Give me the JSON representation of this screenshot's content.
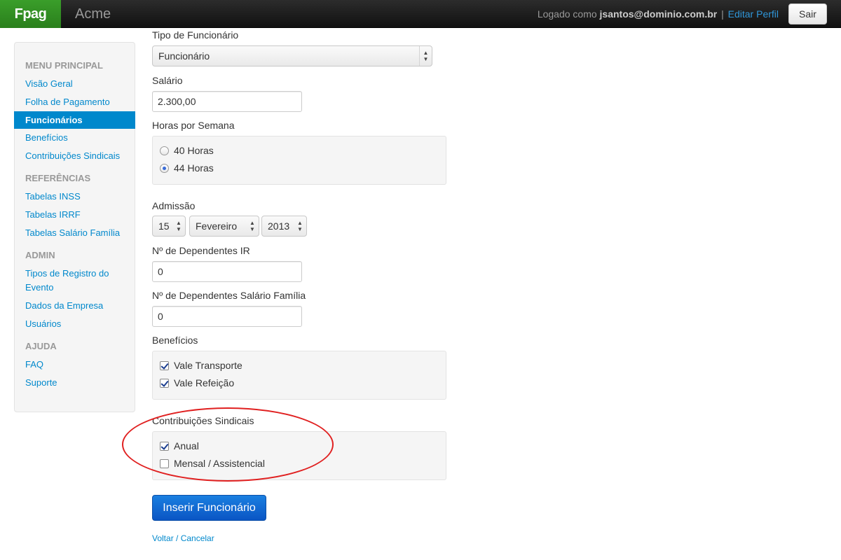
{
  "navbar": {
    "brand": "Fpag",
    "company": "Acme",
    "logged_as_prefix": "Logado como ",
    "username": "jsantos@dominio.com.br",
    "separator": "|",
    "edit_profile": "Editar Perfil",
    "logout": "Sair"
  },
  "sidebar": {
    "sections": [
      {
        "header": "MENU PRINCIPAL",
        "items": [
          "Visão Geral",
          "Folha de Pagamento",
          "Funcionários",
          "Benefícios",
          "Contribuições Sindicais"
        ]
      },
      {
        "header": "REFERÊNCIAS",
        "items": [
          "Tabelas INSS",
          "Tabelas IRRF",
          "Tabelas Salário Família"
        ]
      },
      {
        "header": "ADMIN",
        "items": [
          "Tipos de Registro do",
          "Evento",
          "Dados da Empresa",
          "Usuários"
        ]
      },
      {
        "header": "AJUDA",
        "items": [
          "FAQ",
          "Suporte"
        ]
      }
    ],
    "active": "Funcionários"
  },
  "form": {
    "tipo_label": "Tipo de Funcionário",
    "tipo_value": "Funcionário",
    "salario_label": "Salário",
    "salario_value": "2.300,00",
    "horas_label": "Horas por Semana",
    "horas_options": [
      "40 Horas",
      "44 Horas"
    ],
    "horas_selected": "44 Horas",
    "admissao_label": "Admissão",
    "admissao_day": "15",
    "admissao_month": "Fevereiro",
    "admissao_year": "2013",
    "dep_ir_label": "Nº de Dependentes IR",
    "dep_ir_value": "0",
    "dep_sf_label": "Nº de Dependentes Salário Família",
    "dep_sf_value": "0",
    "beneficios_label": "Benefícios",
    "beneficios_options": [
      "Vale Transporte",
      "Vale Refeição"
    ],
    "contrib_label": "Contribuições Sindicais",
    "contrib_options": [
      "Anual",
      "Mensal / Assistencial"
    ],
    "submit_label": "Inserir Funcionário",
    "cancel_label": "Voltar / Cancelar"
  },
  "colors": {
    "brand": "#2a8a1f",
    "link": "#0088cc",
    "primary_button": "#0a55c4",
    "highlight": "#e02020"
  }
}
